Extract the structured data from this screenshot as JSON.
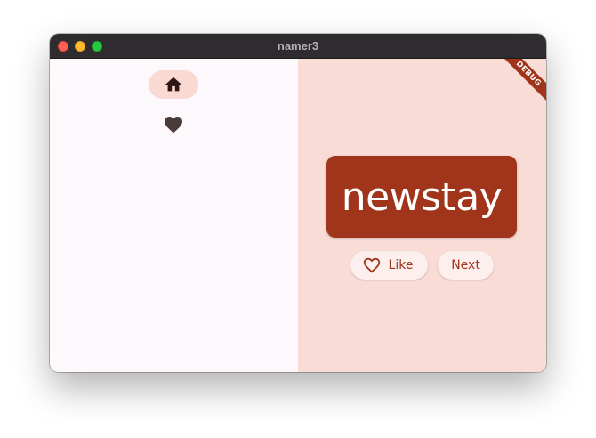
{
  "window": {
    "title": "namer3"
  },
  "rail": {
    "items": [
      {
        "icon": "home-icon",
        "selected": true
      },
      {
        "icon": "heart-icon",
        "selected": false
      }
    ]
  },
  "main": {
    "word": "newstay",
    "like_label": "Like",
    "next_label": "Next",
    "debug_banner": "DEBUG"
  },
  "colors": {
    "primary": "#a1351b",
    "indicator": "#f9d9d1",
    "main_background": "#f9dcd5",
    "rail_background": "#fcf8fc",
    "button_background": "#fcefee"
  }
}
